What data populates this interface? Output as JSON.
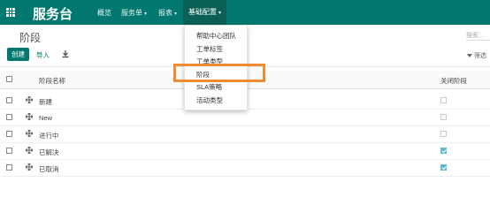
{
  "topbar": {
    "app_title": "服务台",
    "menu": [
      {
        "label": "概览",
        "caret": ""
      },
      {
        "label": "服务单",
        "caret": "▾"
      },
      {
        "label": "报表",
        "caret": "▾"
      },
      {
        "label": "基础配置",
        "caret": "▾"
      }
    ],
    "active_menu": "基础配置"
  },
  "control_panel": {
    "title": "阶段",
    "search_placeholder": "搜索...",
    "create_label": "创建",
    "import_label": "导入",
    "filter_label": "筛选"
  },
  "table": {
    "headers": {
      "name": "阶段名称",
      "fold": "关闭阶段"
    },
    "rows": [
      {
        "name": "新建",
        "fold": false
      },
      {
        "name": "New",
        "fold": false
      },
      {
        "name": "进行中",
        "fold": false
      },
      {
        "name": "已解决",
        "fold": true
      },
      {
        "name": "已取消",
        "fold": true
      }
    ]
  },
  "dropdown": {
    "items": [
      "帮助中心团队",
      "工单标签",
      "工单类型",
      "阶段",
      "SLA策略",
      "活动类型"
    ],
    "highlighted": "阶段"
  },
  "colors": {
    "brand": "#00786f",
    "highlight_box": "#f08a33",
    "checked": "#5fb9c8"
  }
}
